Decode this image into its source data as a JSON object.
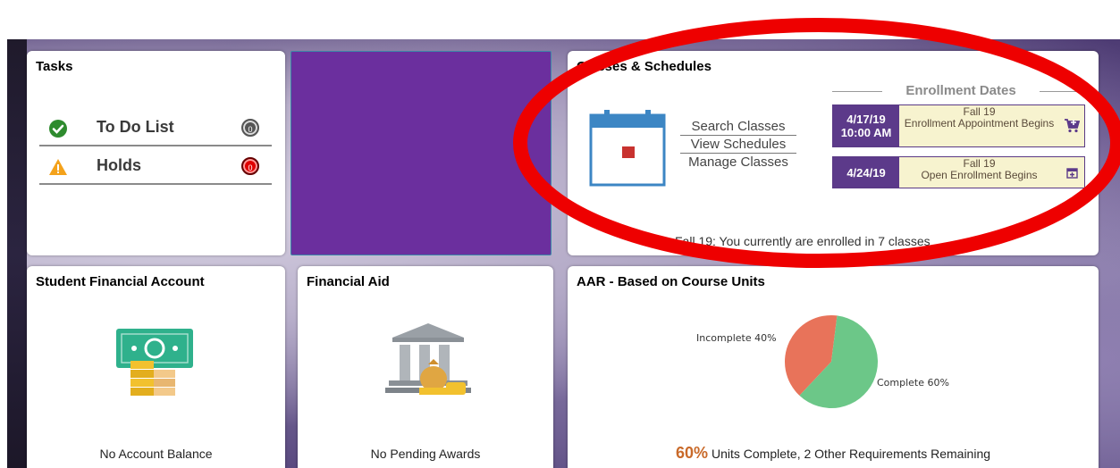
{
  "tasks": {
    "title": "Tasks",
    "items": [
      {
        "label": "To Do List",
        "count": "0"
      },
      {
        "label": "Holds",
        "count": "0"
      }
    ]
  },
  "classes": {
    "title": "Classes & Schedules",
    "links": [
      "Search Classes",
      "View Schedules",
      "Manage Classes"
    ],
    "enrollment_header": "Enrollment Dates",
    "enrollment": [
      {
        "date_line1": "4/17/19",
        "date_line2": "10:00 AM",
        "term": "Fall 19",
        "desc": "Enrollment Appointment Begins"
      },
      {
        "date_line1": "4/24/19",
        "date_line2": "",
        "term": "Fall 19",
        "desc": "Open Enrollment Begins"
      }
    ],
    "footer": "Fall 19: You currently are enrolled in 7 classes"
  },
  "sfa": {
    "title": "Student Financial Account",
    "status": "No Account Balance"
  },
  "financial_aid": {
    "title": "Financial Aid",
    "status": "No Pending Awards"
  },
  "aar": {
    "title": "AAR - Based on Course Units",
    "pct": "60%",
    "summary": "Units Complete, 2 Other Requirements Remaining",
    "pie_labels": {
      "incomplete": "Incomplete 40%",
      "complete": "Complete 60%"
    }
  },
  "chart_data": {
    "type": "pie",
    "categories": [
      "Incomplete",
      "Complete"
    ],
    "values": [
      40,
      60
    ],
    "colors": [
      "#e8735a",
      "#6cc788"
    ]
  },
  "colors": {
    "purple": "#6b2f9e",
    "enroll_purple": "#5c3a8a",
    "annotation_red": "#ee0000"
  }
}
